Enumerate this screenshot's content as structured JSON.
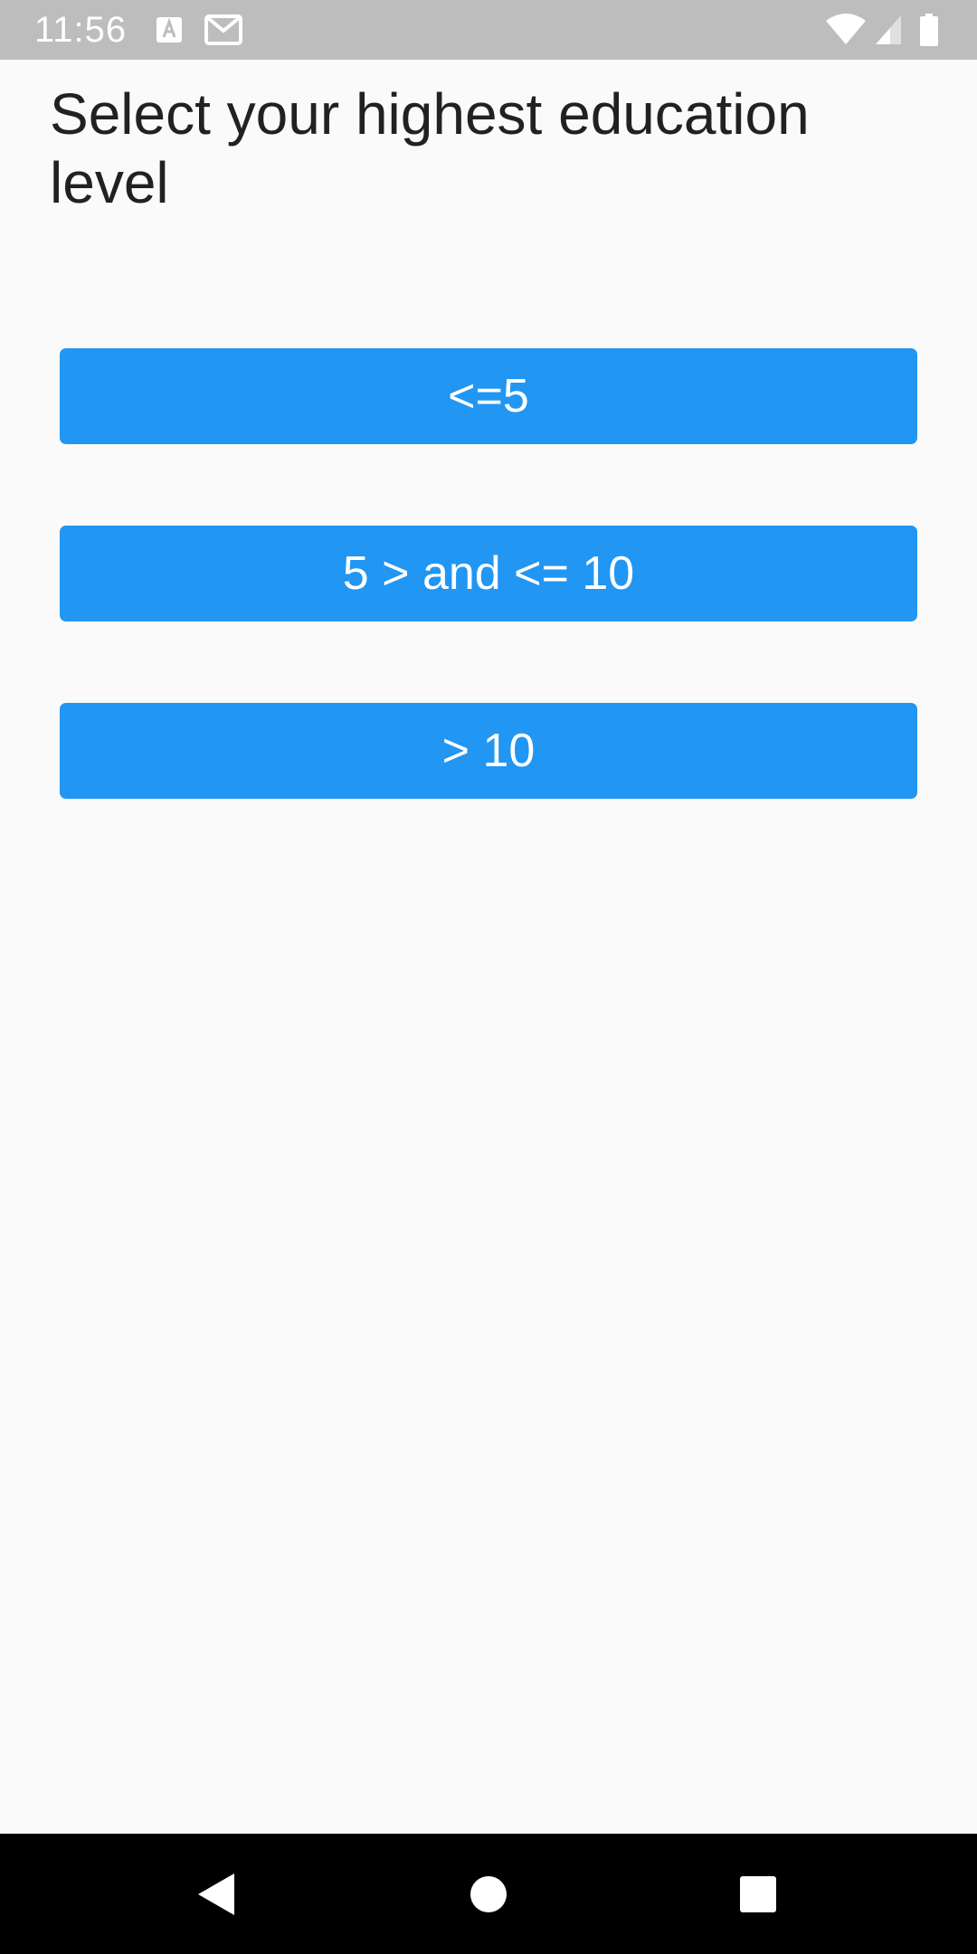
{
  "status_bar": {
    "time": "11:56",
    "icons": [
      "text-a-notification-icon",
      "mail-notification-icon",
      "wifi-icon",
      "signal-icon",
      "battery-icon"
    ]
  },
  "page": {
    "title": "Select your highest education level"
  },
  "options": [
    {
      "label": "<=5"
    },
    {
      "label": "5 > and <= 10"
    },
    {
      "label": "> 10"
    }
  ],
  "navigation": {
    "icons": [
      "back-icon",
      "home-icon",
      "recents-icon"
    ]
  },
  "colors": {
    "accent": "#2196f3",
    "background": "#fafafa",
    "status_bar": "#bdbdbd",
    "nav_bar": "#000000",
    "title_text": "#212121"
  }
}
